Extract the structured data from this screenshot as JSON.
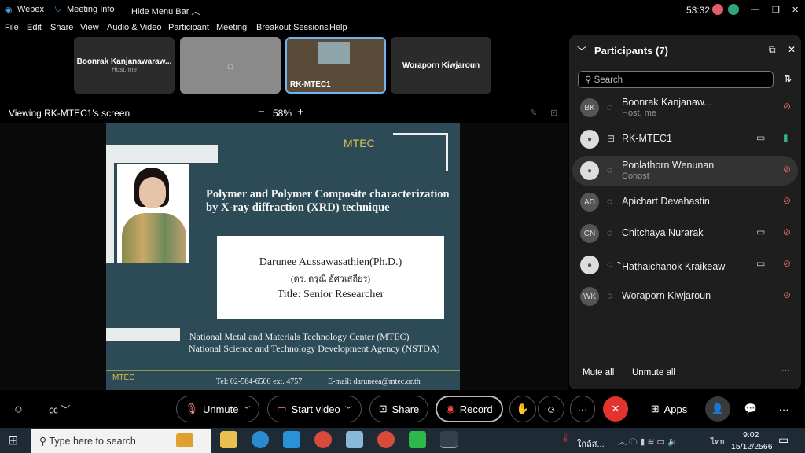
{
  "topbar": {
    "app": "Webex",
    "meeting_info": "Meeting Info",
    "hide_menu": "Hide Menu Bar",
    "timer": "53:32"
  },
  "menu": [
    "File",
    "Edit",
    "Share",
    "View",
    "Audio & Video",
    "Participant",
    "Meeting",
    "Breakout Sessions",
    "Help"
  ],
  "thumbnails": [
    {
      "name": "Boonrak Kanjanawaraw...",
      "sub": "Host, me"
    },
    {
      "name": "RK-MTEC1"
    },
    {
      "name": "Woraporn Kiwjaroun"
    }
  ],
  "viewing": {
    "label": "Viewing RK-MTEC1's screen",
    "zoom": "58%"
  },
  "slide": {
    "logo": "MTEC",
    "title1": "Polymer and Polymer Composite characterization",
    "title2": "by X-ray diffraction (XRD) technique",
    "name": "Darunee Aussawasathien(Ph.D.)",
    "thai_name": "(ดร. ดรุณี อัศวเสถียร)",
    "position": "Title: Senior Researcher",
    "org1": "National Metal and Materials Technology Center (MTEC)",
    "org2": "National Science and Technology Development Agency (NSTDA)",
    "tel": "Tel: 02-564-6500 ext. 4757",
    "email": "E-mail: daruneea@mtec.or.th"
  },
  "participants": {
    "title": "Participants (7)",
    "search_placeholder": "Search",
    "list": [
      {
        "initials": "BK",
        "name": "Boonrak Kanjanaw...",
        "role": "Host, me",
        "mic": "muted"
      },
      {
        "initials": "",
        "name": "RK-MTEC1",
        "role": "",
        "mic": "active",
        "video": true
      },
      {
        "initials": "",
        "name": "Ponlathorn Wenunan",
        "role": "Cohost",
        "mic": "muted"
      },
      {
        "initials": "AD",
        "name": "Apichart Devahastin",
        "role": "",
        "mic": "muted"
      },
      {
        "initials": "CN",
        "name": "Chitchaya Nurarak",
        "role": "",
        "mic": "muted",
        "video": true
      },
      {
        "initials": "",
        "name": "ิHathaichanok Kraikeaw",
        "role": "",
        "mic": "muted",
        "video": true
      },
      {
        "initials": "WK",
        "name": "Woraporn Kiwjaroun",
        "role": "",
        "mic": "muted"
      }
    ],
    "mute_all": "Mute all",
    "unmute_all": "Unmute all"
  },
  "controls": {
    "unmute": "Unmute",
    "start_video": "Start video",
    "share": "Share",
    "record": "Record",
    "apps": "Apps"
  },
  "taskbar": {
    "search_placeholder": "Type here to search",
    "weather": "ใกล้ส...",
    "lang": "ไทย",
    "time": "9:02",
    "date": "15/12/2566"
  },
  "colors": {
    "accent": "#4a9be8",
    "end": "#e3332f",
    "slide_bg": "#2c4b57"
  }
}
